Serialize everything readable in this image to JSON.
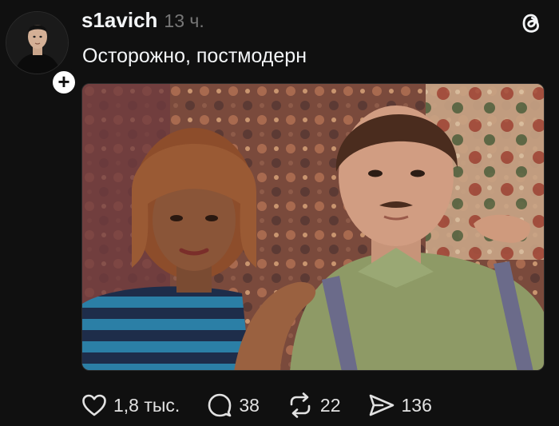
{
  "post": {
    "author": "s1avich",
    "time": "13 ч.",
    "text": "Осторожно, постмодерн"
  },
  "follow": {
    "symbol": "+"
  },
  "media": {
    "type": "photo"
  },
  "actions": {
    "likes": "1,8 тыс.",
    "replies": "38",
    "reposts": "22",
    "shares": "136"
  },
  "icons": [
    "user-avatar",
    "plus-icon",
    "threads-logo-icon",
    "heart-icon",
    "comment-icon",
    "repost-icon",
    "share-icon"
  ],
  "colors": {
    "background": "#101010",
    "text": "#f3f5f7",
    "muted": "#777777"
  }
}
